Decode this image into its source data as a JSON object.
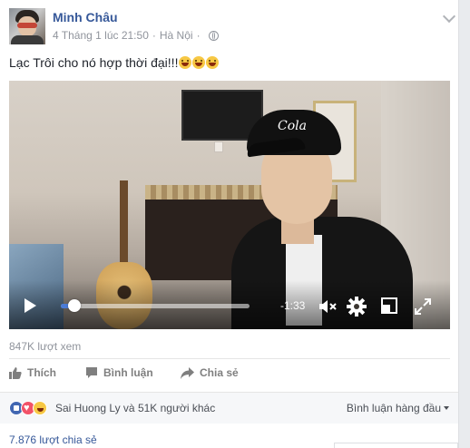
{
  "post": {
    "author": "Minh Châu",
    "timestamp": "4 Tháng 1 lúc 21:50",
    "separator": "·",
    "location": "Hà Nội",
    "caption": "Lạc Trôi cho nó hợp thời đại!!!",
    "caption_emoji_count": 3
  },
  "video": {
    "overlay_text": "Cola",
    "time_remaining": "-1:33",
    "progress": 0.07
  },
  "stats": {
    "views": "847K lượt xem",
    "reactions_text": "Sai Huong Ly và 51K người khác",
    "shares": "7.876 lượt chia sẻ",
    "sort_label": "Bình luận hàng đầu"
  },
  "actions": {
    "like": "Thích",
    "comment": "Bình luận",
    "share": "Chia sẻ"
  },
  "icons": [
    "globe-icon",
    "chevron-down-icon",
    "play-icon",
    "mute-icon",
    "gear-icon",
    "pip-icon",
    "fullscreen-icon",
    "like-icon",
    "love-icon",
    "haha-icon",
    "comment-icon",
    "share-icon"
  ],
  "colors": {
    "link": "#365899",
    "meta": "#90949c",
    "progress": "#4b7bd6",
    "like": "#4267b2",
    "love": "#f25268"
  }
}
